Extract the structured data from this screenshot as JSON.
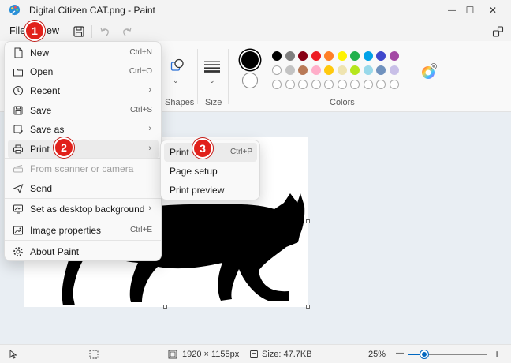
{
  "window": {
    "title": "Digital Citizen CAT.png - Paint",
    "min_glyph": "—",
    "max_glyph": "☐",
    "close_glyph": "✕"
  },
  "menubar": {
    "file_label": "File",
    "view_label_partial": "ew"
  },
  "ribbon": {
    "shapes_label": "Shapes",
    "size_label": "Size",
    "colors_label": "Colors",
    "palette_row1": [
      "#000000",
      "#7f7f7f",
      "#880015",
      "#ed1c24",
      "#ff7f27",
      "#fff200",
      "#22b14c",
      "#00a2e8",
      "#3f48cc",
      "#a349a4"
    ],
    "palette_row2": [
      "#ffffff",
      "#c3c3c3",
      "#b97a57",
      "#ffaec9",
      "#ffc90e",
      "#efe4b0",
      "#b5e61d",
      "#99d9ea",
      "#7092be",
      "#c8bfe7"
    ]
  },
  "file_menu": {
    "items": [
      {
        "label": "New",
        "shortcut": "Ctrl+N",
        "icon": "new-file-icon"
      },
      {
        "label": "Open",
        "shortcut": "Ctrl+O",
        "icon": "open-folder-icon"
      },
      {
        "label": "Recent",
        "shortcut": "",
        "icon": "clock-icon"
      },
      {
        "label": "Save",
        "shortcut": "Ctrl+S",
        "icon": "save-icon"
      },
      {
        "label": "Save as",
        "shortcut": "",
        "icon": "save-as-icon"
      },
      {
        "label": "Print",
        "shortcut": "",
        "icon": "printer-icon"
      },
      {
        "label": "From scanner or camera",
        "shortcut": "",
        "icon": "scanner-icon"
      },
      {
        "label": "Send",
        "shortcut": "",
        "icon": "send-icon"
      },
      {
        "label": "Set as desktop background",
        "shortcut": "",
        "icon": "desktop-icon"
      },
      {
        "label": "Image properties",
        "shortcut": "Ctrl+E",
        "icon": "image-properties-icon"
      },
      {
        "label": "About Paint",
        "shortcut": "",
        "icon": "gear-icon"
      }
    ],
    "arrow_glyph": "›"
  },
  "print_submenu": {
    "items": [
      {
        "label": "Print",
        "shortcut": "Ctrl+P"
      },
      {
        "label": "Page setup",
        "shortcut": ""
      },
      {
        "label": "Print preview",
        "shortcut": ""
      }
    ]
  },
  "badges": [
    "1",
    "2",
    "3"
  ],
  "statusbar": {
    "dimensions": "1920 × 1155px",
    "size": "Size: 47.7KB",
    "zoom": "25%",
    "zoom_level": 0.2,
    "minus_glyph": "—",
    "plus_glyph": "+"
  }
}
